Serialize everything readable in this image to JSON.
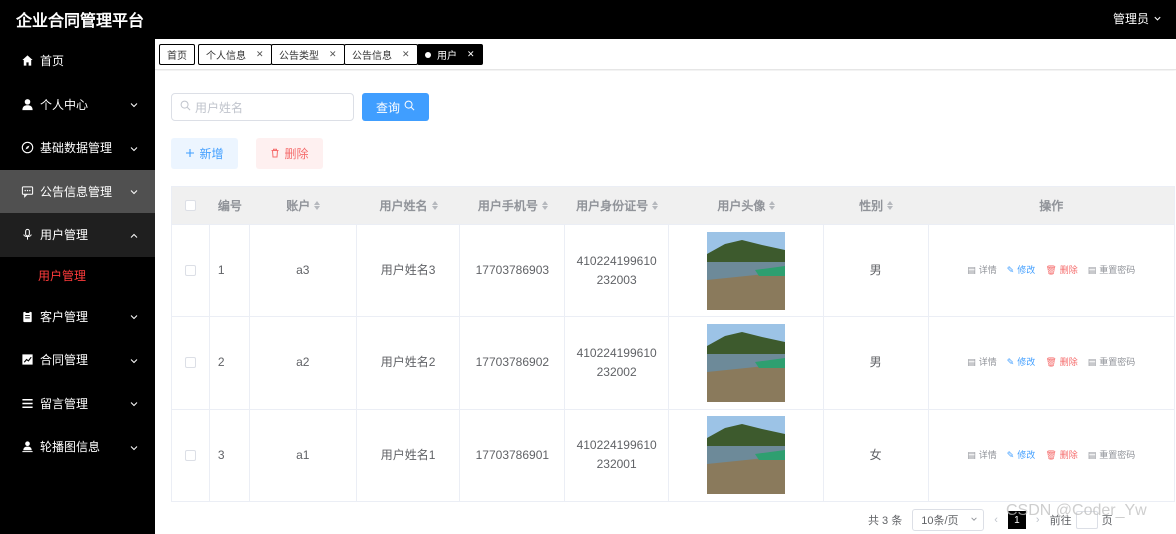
{
  "app": {
    "title": "企业合同管理平台",
    "user": "管理员"
  },
  "sidebar": {
    "items": [
      {
        "label": "首页"
      },
      {
        "label": "个人中心"
      },
      {
        "label": "基础数据管理"
      },
      {
        "label": "公告信息管理"
      },
      {
        "label": "用户管理"
      },
      {
        "label": "客户管理"
      },
      {
        "label": "合同管理"
      },
      {
        "label": "留言管理"
      },
      {
        "label": "轮播图信息"
      }
    ],
    "sub_active": "用户管理"
  },
  "tabs": [
    {
      "label": "首页"
    },
    {
      "label": "个人信息"
    },
    {
      "label": "公告类型"
    },
    {
      "label": "公告信息"
    },
    {
      "label": "用户"
    }
  ],
  "toolbar": {
    "search_placeholder": "用户姓名",
    "search_button": "查询",
    "add_button": "新增",
    "delete_button": "删除"
  },
  "table": {
    "columns": [
      "编号",
      "账户",
      "用户姓名",
      "用户手机号",
      "用户身份证号",
      "用户头像",
      "性别",
      "操作"
    ],
    "rows": [
      {
        "id": "1",
        "account": "a3",
        "name": "用户姓名3",
        "phone": "17703786903",
        "idcard": "410224199610232003",
        "gender": "男"
      },
      {
        "id": "2",
        "account": "a2",
        "name": "用户姓名2",
        "phone": "17703786902",
        "idcard": "410224199610232002",
        "gender": "男"
      },
      {
        "id": "3",
        "account": "a1",
        "name": "用户姓名1",
        "phone": "17703786901",
        "idcard": "410224199610232001",
        "gender": "女"
      }
    ],
    "actions": {
      "detail": "详情",
      "edit": "修改",
      "remove": "删除",
      "reset": "重置密码"
    }
  },
  "pagination": {
    "total": "共 3 条",
    "page_size": "10条/页",
    "current": "1",
    "goto": "前往",
    "goto_suffix": "页"
  },
  "watermark": "CSDN @Coder_Yw",
  "colors": {
    "primary": "#409eff",
    "danger": "#f56c6c",
    "sidebar_bg": "#000000",
    "active_sub": "#ff3b3b"
  }
}
